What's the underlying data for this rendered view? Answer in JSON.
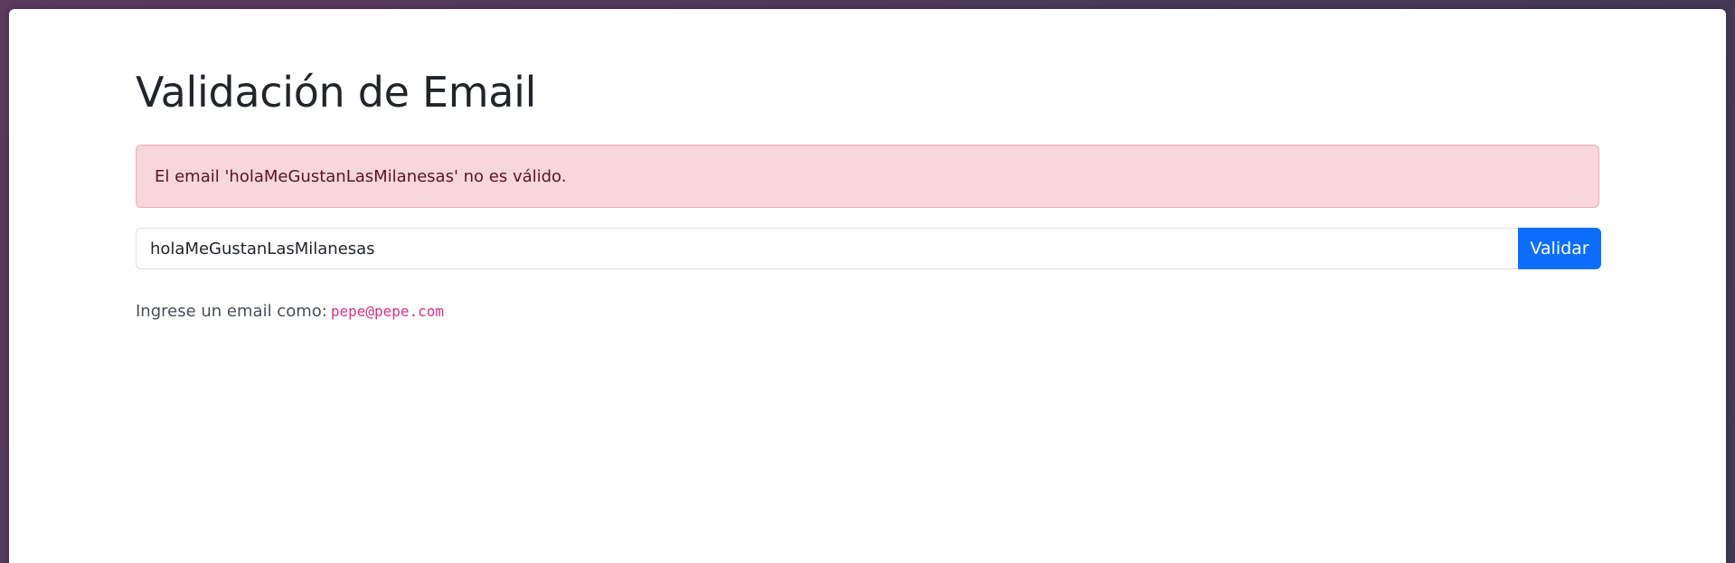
{
  "page": {
    "title": "Validación de Email"
  },
  "alert": {
    "message": "El email 'holaMeGustanLasMilanesas' no es válido.",
    "type": "danger"
  },
  "form": {
    "email_value": "holaMeGustanLasMilanesas",
    "validate_label": "Validar"
  },
  "hint": {
    "text": "Ingrese un email como:",
    "example": "pepe@pepe.com"
  },
  "colors": {
    "primary": "#0d6efd",
    "alert_bg": "#f8d7da",
    "alert_text": "#58151c",
    "code": "#d63384"
  }
}
